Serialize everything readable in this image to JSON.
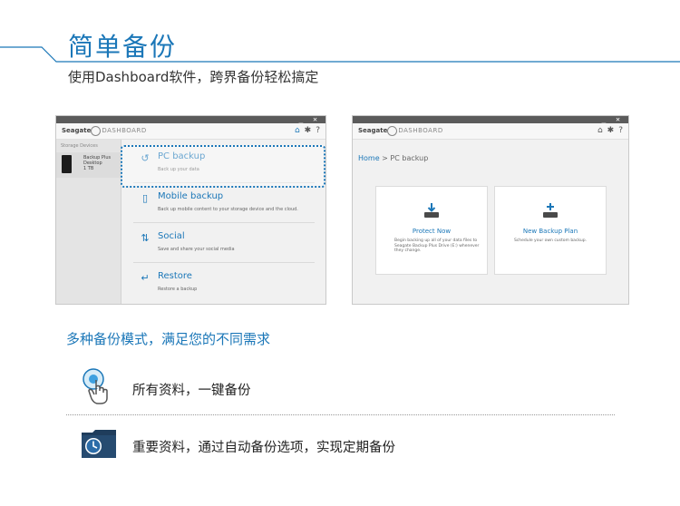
{
  "header": {
    "title": "简单备份",
    "subtitle": "使用Dashboard软件，跨界备份轻松搞定"
  },
  "left_window": {
    "brand": "Seagate",
    "product": "DASHBOARD",
    "sidebar": {
      "label": "Storage Devices",
      "device_name": "Backup Plus Desktop",
      "device_size": "1 TB"
    },
    "menu": [
      {
        "title": "PC backup",
        "desc": "Back up your data",
        "icon": "restore-arrow-icon"
      },
      {
        "title": "Mobile backup",
        "desc": "Back up mobile content to your storage device and the cloud.",
        "icon": "phone-icon"
      },
      {
        "title": "Social",
        "desc": "Save and share your social media",
        "icon": "transfer-arrows-icon"
      },
      {
        "title": "Restore",
        "desc": "Restore a backup",
        "icon": "return-arrow-icon"
      }
    ]
  },
  "right_window": {
    "brand": "Seagate",
    "product": "DASHBOARD",
    "breadcrumb": {
      "home": "Home",
      "current": "PC backup"
    },
    "cards": [
      {
        "title": "Protect Now",
        "desc": "Begin backing up all of your data files to Seagate Backup Plus Drive (E:) whenever they change."
      },
      {
        "title": "New Backup Plan",
        "desc": "Schedule your own custom backup."
      }
    ]
  },
  "features": {
    "title": "多种备份模式，满足您的不同需求",
    "items": [
      {
        "text": "所有资料，一键备份",
        "icon": "touch-hand-icon"
      },
      {
        "text": "重要资料，通过自动备份选项，实现定期备份",
        "icon": "clock-folder-icon"
      }
    ]
  },
  "colors": {
    "accent": "#1b77b8",
    "window_top": "#5b5b5b"
  }
}
